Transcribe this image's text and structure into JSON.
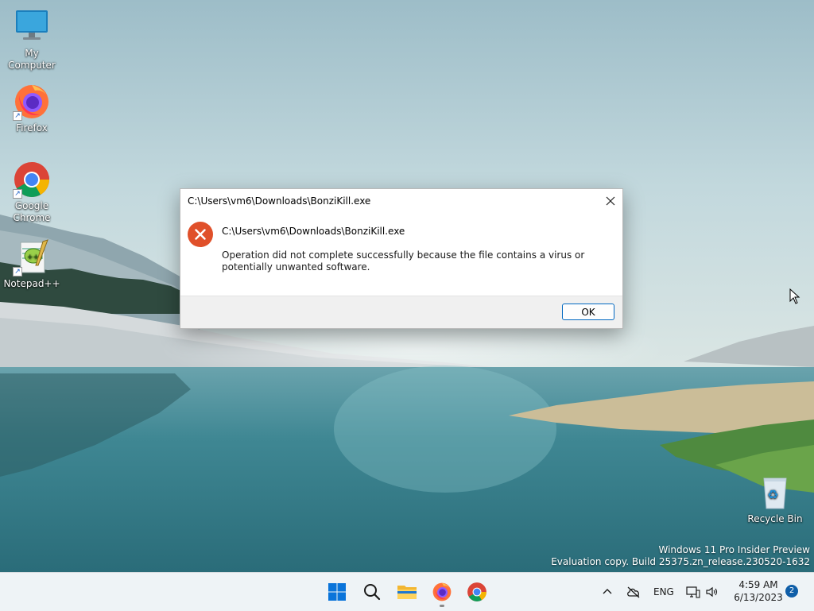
{
  "desktop": {
    "icons": [
      {
        "label": "My Computer"
      },
      {
        "label": "Firefox"
      },
      {
        "label": "Google Chrome"
      },
      {
        "label": "Notepad++"
      },
      {
        "label": "Recycle Bin"
      }
    ]
  },
  "dialog": {
    "title": "C:\\Users\\vm6\\Downloads\\BonziKill.exe",
    "path": "C:\\Users\\vm6\\Downloads\\BonziKill.exe",
    "message": "Operation did not complete successfully because the file contains a virus or potentially unwanted software.",
    "ok_label": "OK"
  },
  "watermark": {
    "line1": "Windows 11 Pro Insider Preview",
    "line2": "Evaluation copy. Build 25375.zn_release.230520-1632"
  },
  "taskbar": {
    "language": "ENG",
    "time": "4:59 AM",
    "date": "6/13/2023",
    "notification_count": "2"
  },
  "colors": {
    "error_red": "#e0502a",
    "accent": "#0067c0"
  }
}
